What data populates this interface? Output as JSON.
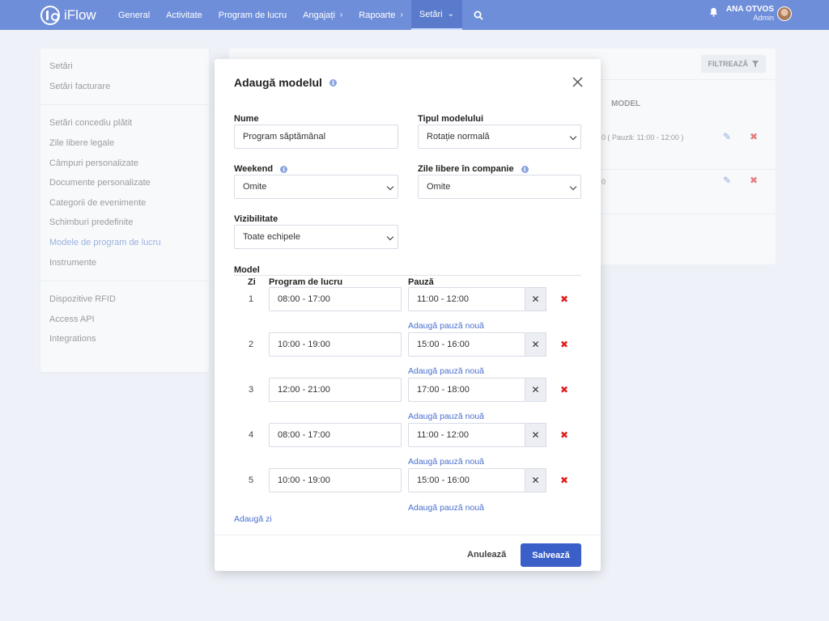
{
  "app": {
    "logo_text": "iFlow"
  },
  "nav": {
    "items": [
      {
        "label": "General"
      },
      {
        "label": "Activitate"
      },
      {
        "label": "Program de lucru"
      },
      {
        "label": "Angajați",
        "caret": "›"
      },
      {
        "label": "Rapoarte",
        "caret": "›"
      },
      {
        "label": "Setări",
        "caret": "⌄"
      }
    ]
  },
  "user": {
    "name": "ANA OTVOS",
    "role": "Admin"
  },
  "sidebar": {
    "group1": [
      {
        "label": "Setări"
      },
      {
        "label": "Setări facturare"
      }
    ],
    "group2": [
      {
        "label": "Setări concediu plătit"
      },
      {
        "label": "Zile libere legale"
      },
      {
        "label": "Câmpuri personalizate"
      },
      {
        "label": "Documente personalizate"
      },
      {
        "label": "Categorii de evenimente"
      },
      {
        "label": "Schimburi predefinite"
      },
      {
        "label": "Modele de program de lucru"
      },
      {
        "label": "Instrumente"
      }
    ],
    "group3": [
      {
        "label": "Dispozitive RFID"
      },
      {
        "label": "Access API"
      },
      {
        "label": "Integrations"
      }
    ]
  },
  "background": {
    "filter_label": "FILTREAZĂ",
    "column_model": "MODEL",
    "rows": [
      {
        "text": "0  ( Pauză: 11:00 - 12:00 )"
      },
      {
        "text": "0"
      }
    ]
  },
  "modal": {
    "title": "Adaugă modelul",
    "fields": {
      "name_label": "Nume",
      "name_value": "Program săptămânal",
      "type_label": "Tipul modelului",
      "type_value": "Rotație normală",
      "weekend_label": "Weekend",
      "weekend_value": "Omite",
      "holidays_label": "Zile libere în companie",
      "holidays_value": "Omite",
      "visibility_label": "Vizibilitate",
      "visibility_value": "Toate echipele"
    },
    "model_label": "Model",
    "headers": {
      "day": "Zi",
      "schedule": "Program de lucru",
      "break": "Pauză"
    },
    "add_break_label": "Adaugă pauză nouă",
    "days": [
      {
        "day": "1",
        "schedule": "08:00 - 17:00",
        "break": "11:00 - 12:00"
      },
      {
        "day": "2",
        "schedule": "10:00 - 19:00",
        "break": "15:00 - 16:00"
      },
      {
        "day": "3",
        "schedule": "12:00 - 21:00",
        "break": "17:00 - 18:00"
      },
      {
        "day": "4",
        "schedule": "08:00 - 17:00",
        "break": "11:00 - 12:00"
      },
      {
        "day": "5",
        "schedule": "10:00 - 19:00",
        "break": "15:00 - 16:00"
      }
    ],
    "add_day_label": "Adaugă zi",
    "cancel_label": "Anulează",
    "save_label": "Salvează"
  }
}
